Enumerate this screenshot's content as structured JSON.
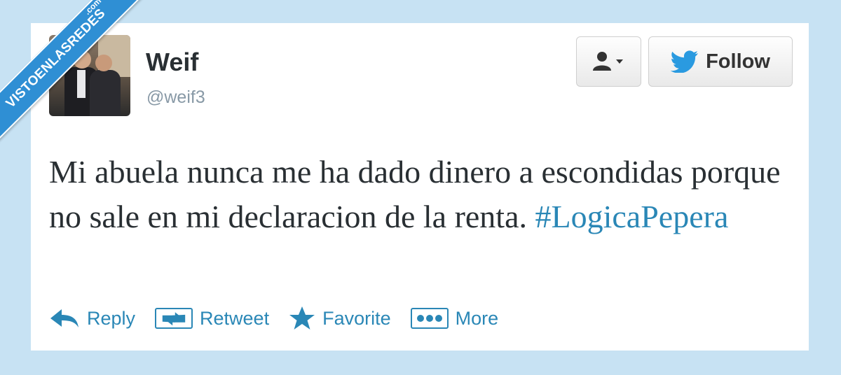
{
  "watermark": {
    "text": "VISTOENLASREDES",
    "suffix": ".com"
  },
  "author": {
    "name": "Weif",
    "handle": "@weif3"
  },
  "buttons": {
    "user_menu_icon": "user-dropdown-icon",
    "follow_label": "Follow"
  },
  "tweet": {
    "text_before": "Mi abuela nunca me ha dado dinero a escondidas porque no sale en mi declaracion de la renta.",
    "hashtag": "#LogicaPepera"
  },
  "actions": [
    {
      "label": "Reply",
      "icon": "reply-icon"
    },
    {
      "label": "Retweet",
      "icon": "retweet-icon"
    },
    {
      "label": "Favorite",
      "icon": "star-icon"
    },
    {
      "label": "More",
      "icon": "more-icon"
    }
  ],
  "colors": {
    "background": "#c7e2f3",
    "link": "#2a87b6",
    "banner": "#2f8fd4"
  }
}
